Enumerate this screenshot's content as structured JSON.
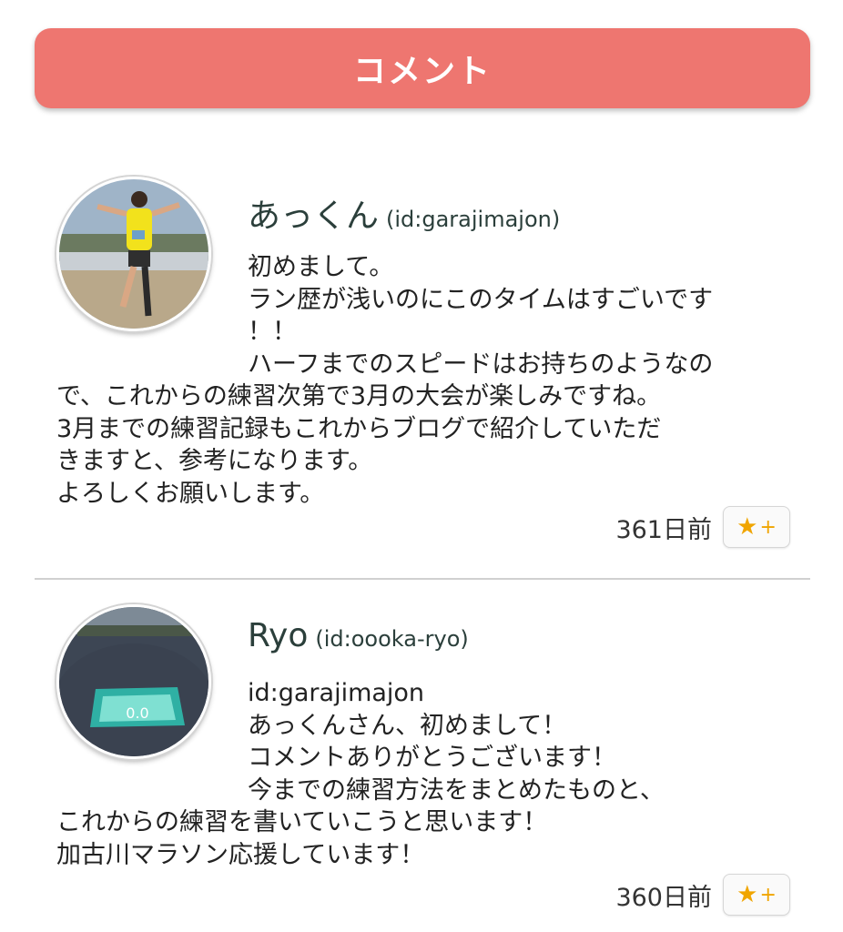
{
  "header": {
    "title": "コメント"
  },
  "comments": [
    {
      "name": "あっくん",
      "id": "(id:garajimajon)",
      "lines": [
        "初めまして。",
        "ラン歴が浅いのにこのタイムはすごいです",
        "！！",
        "ハーフまでのスピードはお持ちのようなの",
        "で、これからの練習次第で3月の大会が楽しみですね。",
        "3月までの練習記録もこれからブログで紹介していただ",
        "きますと、参考になります。",
        "よろしくお願いします。"
      ],
      "time": "361日前",
      "star_icon": "star-icon",
      "star_plus": "+"
    },
    {
      "name": "Ryo",
      "id": "(id:oooka-ryo)",
      "lines": [
        "id:garajimajon",
        "あっくんさん、初めまして！",
        "コメントありがとうございます！",
        "今までの練習方法をまとめたものと、",
        "これからの練習を書いていこうと思います！",
        "加古川マラソン応援しています！"
      ],
      "time": "360日前",
      "star_icon": "star-icon",
      "star_plus": "+"
    }
  ]
}
